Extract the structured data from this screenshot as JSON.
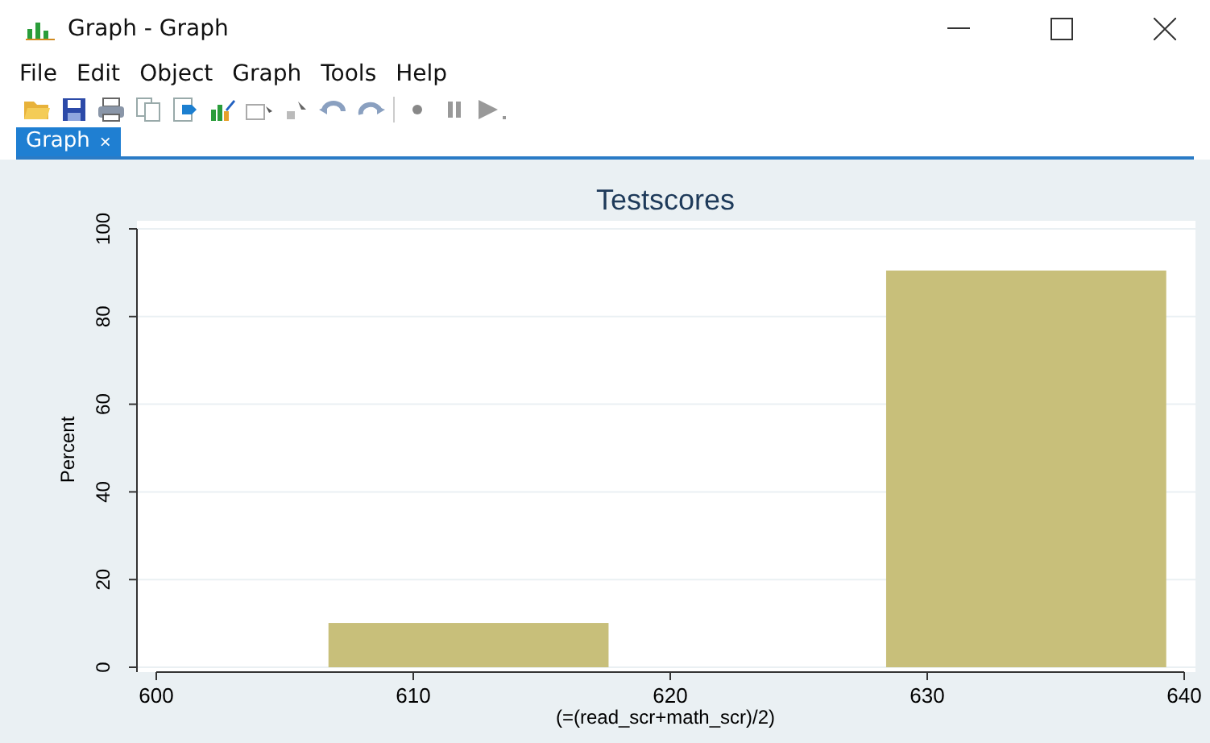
{
  "window": {
    "title": "Graph - Graph"
  },
  "menu": [
    "File",
    "Edit",
    "Object",
    "Graph",
    "Tools",
    "Help"
  ],
  "toolbar": [
    {
      "kind": "open"
    },
    {
      "kind": "save"
    },
    {
      "kind": "print"
    },
    {
      "kind": "copy"
    },
    {
      "kind": "paste"
    },
    {
      "kind": "editor"
    },
    {
      "kind": "frame"
    },
    {
      "kind": "pointer"
    },
    {
      "kind": "undo"
    },
    {
      "kind": "redo"
    },
    {
      "kind": "sep"
    },
    {
      "kind": "record"
    },
    {
      "kind": "pause"
    },
    {
      "kind": "play"
    }
  ],
  "tabs": [
    {
      "label": "Graph",
      "close": "×",
      "selected": true
    }
  ],
  "graph": {
    "chart_data": {
      "type": "bar",
      "title": "Testscores",
      "xlabel": "(=(read_scr+math_scr)/2)",
      "ylabel": "Percent",
      "x": [
        612.15,
        633.85
      ],
      "values": [
        10.1,
        90.5
      ],
      "xlim": [
        600,
        640
      ],
      "ylim": [
        0,
        100
      ],
      "xticks": [
        600,
        610,
        620,
        630,
        640
      ],
      "yticks": [
        0,
        20,
        40,
        60,
        80,
        100
      ],
      "grid": true
    }
  }
}
